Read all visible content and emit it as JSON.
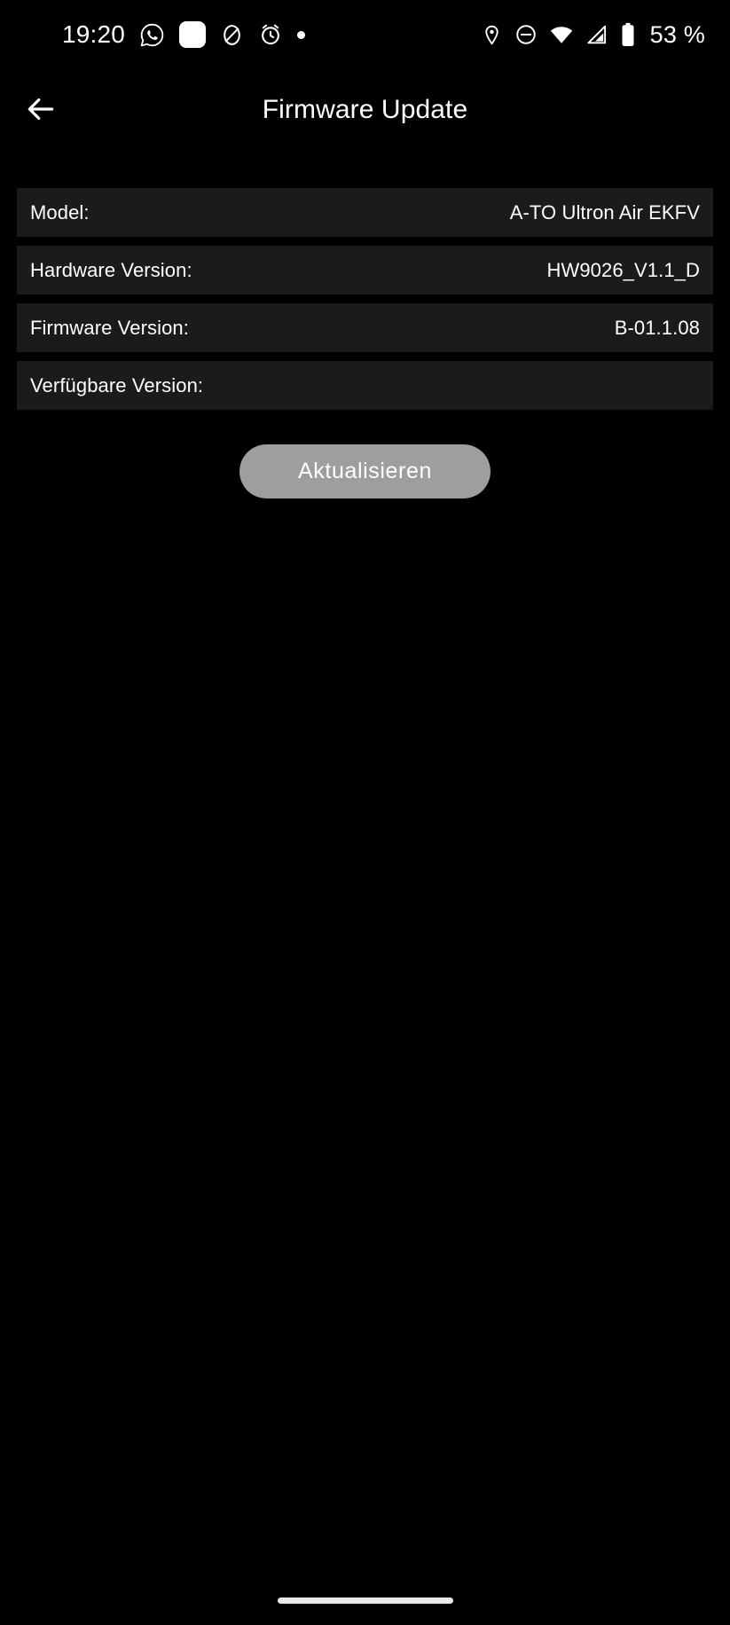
{
  "status_bar": {
    "clock": "19:20",
    "battery_percent": "53 %",
    "left_icons": [
      "whatsapp-icon",
      "rounded-square-icon",
      "do-not-disturb-slash-icon",
      "alarm-clock-icon",
      "dot-icon"
    ],
    "right_icons": [
      "location-pin-icon",
      "do-not-disturb-icon",
      "wifi-icon",
      "cellular-signal-icon",
      "battery-icon"
    ]
  },
  "app_bar": {
    "back_icon": "arrow-left-icon",
    "title": "Firmware Update"
  },
  "info_rows": [
    {
      "label": "Model:",
      "value": "A-TO Ultron Air EKFV"
    },
    {
      "label": "Hardware Version:",
      "value": "HW9026_V1.1_D"
    },
    {
      "label": "Firmware Version:",
      "value": "B-01.1.08"
    },
    {
      "label": "Verfügbare Version:",
      "value": ""
    }
  ],
  "action": {
    "update_label": "Aktualisieren"
  },
  "colors": {
    "background": "#000000",
    "row_background": "#1b1b1b",
    "text": "#ffffff",
    "button_disabled": "#9e9e9e",
    "home_indicator": "#e8e8e8"
  },
  "nav_bar": {
    "home_indicator": "home-indicator"
  }
}
